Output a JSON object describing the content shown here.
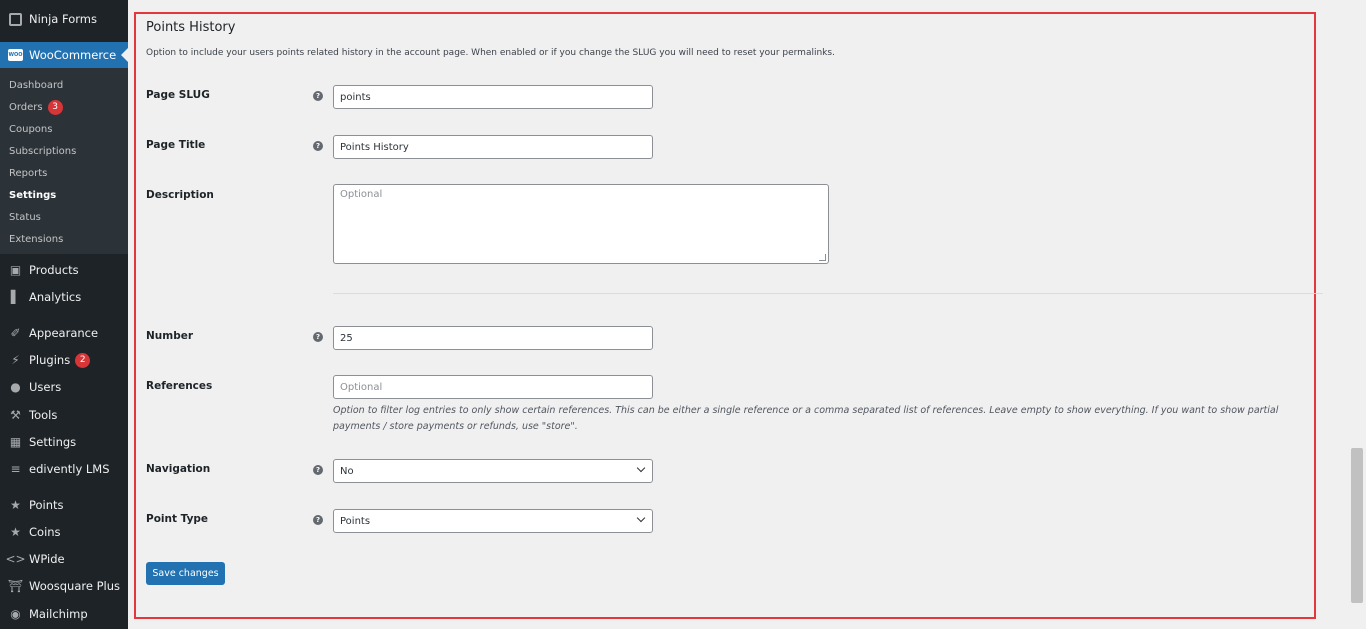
{
  "sidebar": {
    "ninja_forms": "Ninja Forms",
    "woocommerce": "WooCommerce",
    "woo_logo": "WOO",
    "sub": {
      "dashboard": "Dashboard",
      "orders": "Orders",
      "orders_badge": "3",
      "coupons": "Coupons",
      "subscriptions": "Subscriptions",
      "reports": "Reports",
      "settings": "Settings",
      "status": "Status",
      "extensions": "Extensions"
    },
    "products": "Products",
    "analytics": "Analytics",
    "appearance": "Appearance",
    "plugins": "Plugins",
    "plugins_badge": "2",
    "users": "Users",
    "tools": "Tools",
    "settings": "Settings",
    "edivently": "edivently LMS",
    "points": "Points",
    "coins": "Coins",
    "wpide": "WPide",
    "woosquare": "Woosquare Plus",
    "mailchimp": "Mailchimp"
  },
  "section": {
    "title": "Points History",
    "description": "Option to include your users points related history in the account page. When enabled or if you change the SLUG you will need to reset your permalinks."
  },
  "form": {
    "page_slug_label": "Page SLUG",
    "page_slug_value": "points",
    "page_title_label": "Page Title",
    "page_title_value": "Points History",
    "description_label": "Description",
    "description_placeholder": "Optional",
    "number_label": "Number",
    "number_value": "25",
    "references_label": "References",
    "references_placeholder": "Optional",
    "references_hint": "Option to filter log entries to only show certain references. This can be either a single reference or a comma separated list of references. Leave empty to show everything. If you want to show partial payments / store payments or refunds, use \"store\".",
    "navigation_label": "Navigation",
    "navigation_value": "No",
    "point_type_label": "Point Type",
    "point_type_value": "Points",
    "help_glyph": "?",
    "save_label": "Save changes"
  },
  "colors": {
    "accent": "#2271b1",
    "sidebar": "#1d2327",
    "highlight": "#e3363d",
    "badge": "#d63638"
  }
}
